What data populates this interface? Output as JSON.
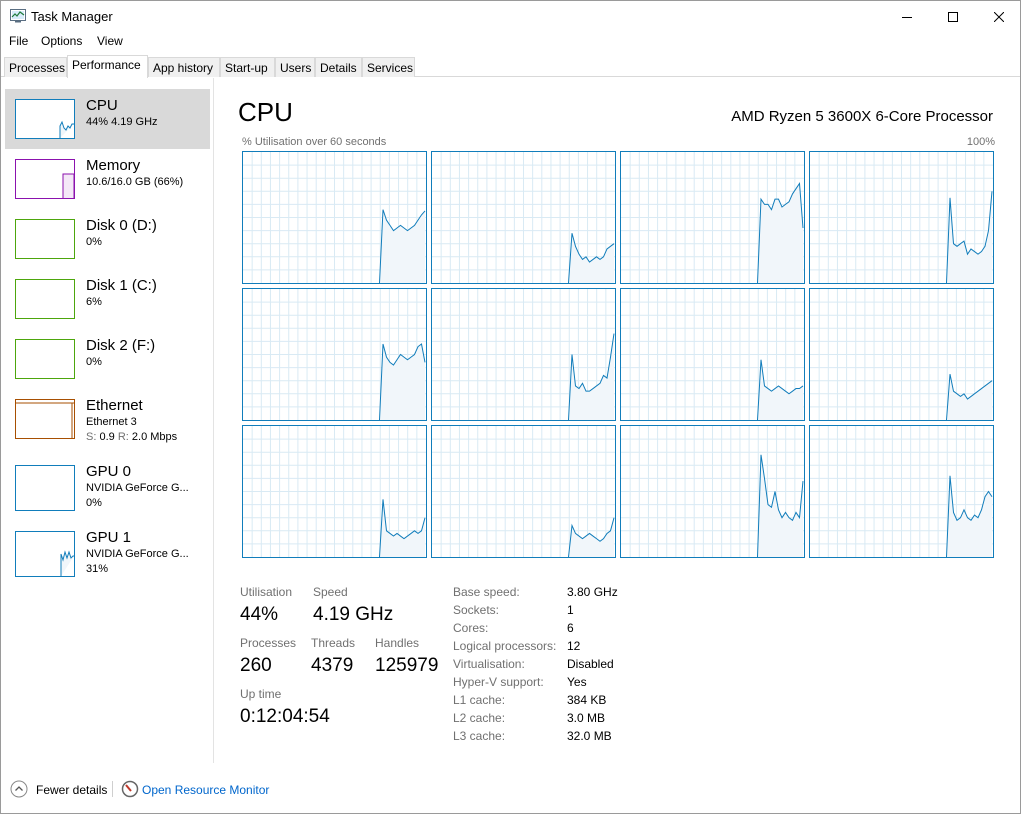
{
  "window": {
    "title": "Task Manager"
  },
  "menu": [
    "File",
    "Options",
    "View"
  ],
  "tabs": [
    "Processes",
    "Performance",
    "App history",
    "Start-up",
    "Users",
    "Details",
    "Services"
  ],
  "sidebar": [
    {
      "title": "CPU",
      "sub1": "44% 4.19 GHz",
      "color": "#117dbb"
    },
    {
      "title": "Memory",
      "sub1": "10.6/16.0 GB (66%)",
      "color": "#8b12ae"
    },
    {
      "title": "Disk 0 (D:)",
      "sub1": "0%",
      "color": "#4da60c"
    },
    {
      "title": "Disk 1 (C:)",
      "sub1": "6%",
      "color": "#4da60c"
    },
    {
      "title": "Disk 2 (F:)",
      "sub1": "0%",
      "color": "#4da60c"
    },
    {
      "title": "Ethernet",
      "sub1": "Ethernet 3",
      "sub2_s": "S:",
      "sub2_sv": "0.9",
      "sub2_r": "R:",
      "sub2_rv": "2.0 Mbps",
      "color": "#a74f01"
    },
    {
      "title": "GPU 0",
      "sub1": "NVIDIA GeForce G...",
      "sub2": "0%",
      "color": "#117dbb"
    },
    {
      "title": "GPU 1",
      "sub1": "NVIDIA GeForce G...",
      "sub2": "31%",
      "color": "#117dbb"
    }
  ],
  "cpu": {
    "title": "CPU",
    "processor": "AMD Ryzen 5 3600X 6-Core Processor",
    "graph_label": "% Utilisation over 60 seconds",
    "graph_max": "100%",
    "stats": {
      "utilisation_label": "Utilisation",
      "utilisation": "44%",
      "speed_label": "Speed",
      "speed": "4.19 GHz",
      "processes_label": "Processes",
      "processes": "260",
      "threads_label": "Threads",
      "threads": "4379",
      "handles_label": "Handles",
      "handles": "125979",
      "uptime_label": "Up time",
      "uptime": "0:12:04:54"
    },
    "info": [
      {
        "label": "Base speed:",
        "value": "3.80 GHz"
      },
      {
        "label": "Sockets:",
        "value": "1"
      },
      {
        "label": "Cores:",
        "value": "6"
      },
      {
        "label": "Logical processors:",
        "value": "12"
      },
      {
        "label": "Virtualisation:",
        "value": "Disabled"
      },
      {
        "label": "Hyper-V support:",
        "value": "Yes"
      },
      {
        "label": "L1 cache:",
        "value": "384 KB"
      },
      {
        "label": "L2 cache:",
        "value": "3.0 MB"
      },
      {
        "label": "L3 cache:",
        "value": "32.0 MB"
      }
    ]
  },
  "footer": {
    "fewer_details": "Fewer details",
    "resource_monitor": "Open Resource Monitor"
  },
  "colors": {
    "cpu_line": "#117dbb",
    "cpu_fill": "#f1f6fa",
    "grid": "#d9eaf4"
  },
  "chart_data": {
    "type": "area",
    "title": "% Utilisation over 60 seconds",
    "ylim": [
      0,
      100
    ],
    "x": [
      45,
      46,
      47,
      48,
      49,
      50,
      51,
      52,
      53,
      54,
      55,
      56,
      57,
      58,
      59,
      60
    ],
    "series": [
      {
        "values": [
          0,
          56,
          48,
          44,
          40,
          42,
          44,
          42,
          40,
          42,
          44,
          48,
          52,
          55
        ]
      },
      {
        "values": [
          0,
          38,
          28,
          22,
          18,
          20,
          16,
          18,
          20,
          18,
          20,
          26,
          28,
          30
        ]
      },
      {
        "values": [
          0,
          64,
          60,
          60,
          56,
          64,
          64,
          58,
          60,
          62,
          68,
          72,
          76,
          42
        ]
      },
      {
        "values": [
          0,
          65,
          30,
          28,
          30,
          32,
          22,
          26,
          24,
          22,
          24,
          28,
          40,
          70
        ]
      },
      {
        "values": [
          0,
          58,
          48,
          44,
          42,
          46,
          50,
          48,
          46,
          48,
          50,
          56,
          58,
          44
        ]
      },
      {
        "values": [
          0,
          50,
          26,
          24,
          28,
          22,
          22,
          24,
          26,
          28,
          34,
          32,
          48,
          66
        ]
      },
      {
        "values": [
          0,
          46,
          26,
          24,
          22,
          24,
          26,
          24,
          22,
          20,
          22,
          24,
          24,
          26
        ]
      },
      {
        "values": [
          0,
          35,
          22,
          20,
          18,
          20,
          16,
          18,
          20,
          22,
          24,
          26,
          28,
          30
        ]
      },
      {
        "values": [
          0,
          44,
          20,
          18,
          16,
          18,
          16,
          14,
          16,
          18,
          20,
          18,
          20,
          30
        ]
      },
      {
        "values": [
          0,
          24,
          18,
          16,
          14,
          16,
          18,
          16,
          14,
          12,
          14,
          18,
          20,
          30
        ]
      },
      {
        "values": [
          0,
          78,
          60,
          40,
          38,
          50,
          36,
          30,
          34,
          30,
          28,
          34,
          30,
          58
        ]
      },
      {
        "values": [
          0,
          62,
          34,
          28,
          30,
          36,
          30,
          28,
          32,
          30,
          36,
          46,
          50,
          46
        ]
      }
    ]
  }
}
